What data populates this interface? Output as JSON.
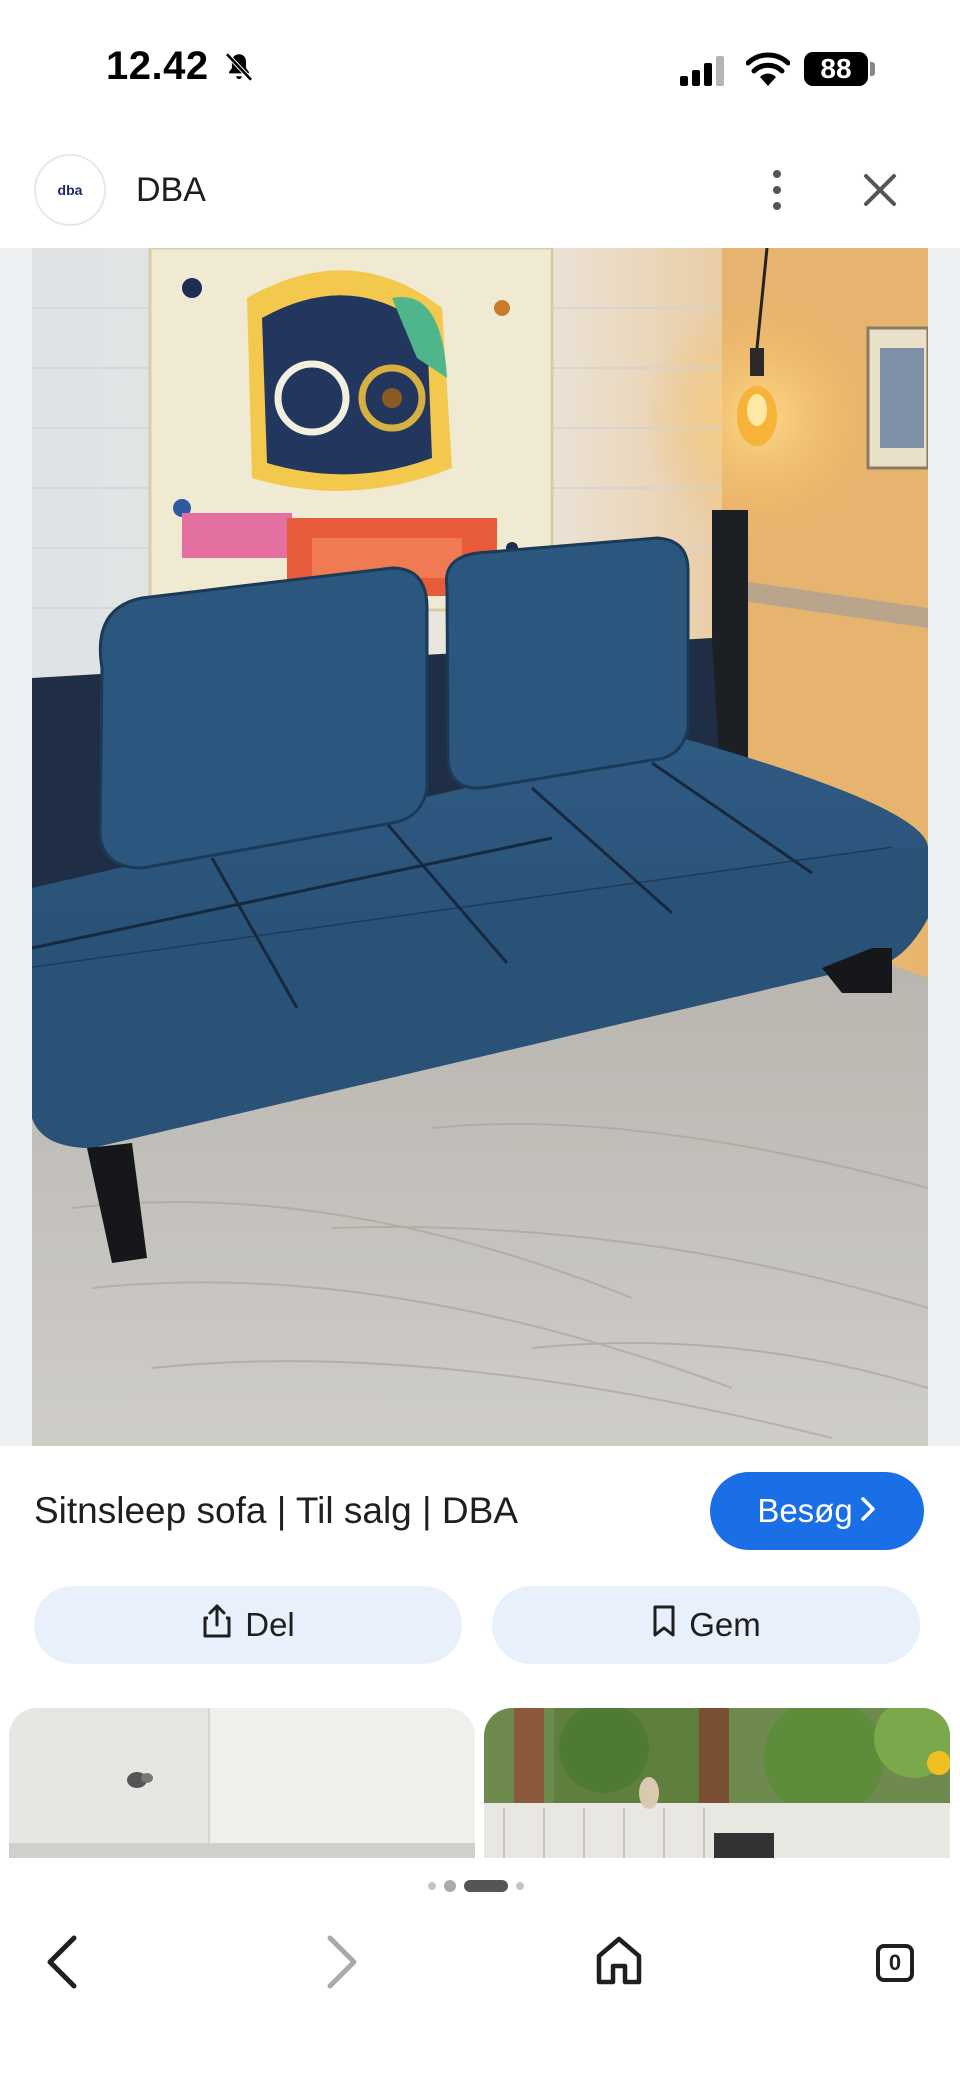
{
  "status_bar": {
    "time": "12.42",
    "battery": "88"
  },
  "header": {
    "site_logo_text": "dba",
    "site_name": "DBA"
  },
  "result": {
    "title": "Sitnsleep sofa | Til salg | DBA",
    "visit_label": "Besøg",
    "share_label": "Del",
    "save_label": "Gem"
  },
  "pagination": {
    "count": 4,
    "active_index": 2
  },
  "tab_count": "0",
  "icons": {
    "bell": "bell-muted-icon",
    "signal": "cellular-signal-icon",
    "wifi": "wifi-icon",
    "more": "more-vert-icon",
    "close": "close-icon",
    "share": "share-icon",
    "save": "bookmark-icon",
    "back": "chevron-left-icon",
    "forward": "chevron-right-icon",
    "home": "home-icon"
  },
  "colors": {
    "accent": "#1a6ee6",
    "pill_bg": "#e8f0fb"
  }
}
